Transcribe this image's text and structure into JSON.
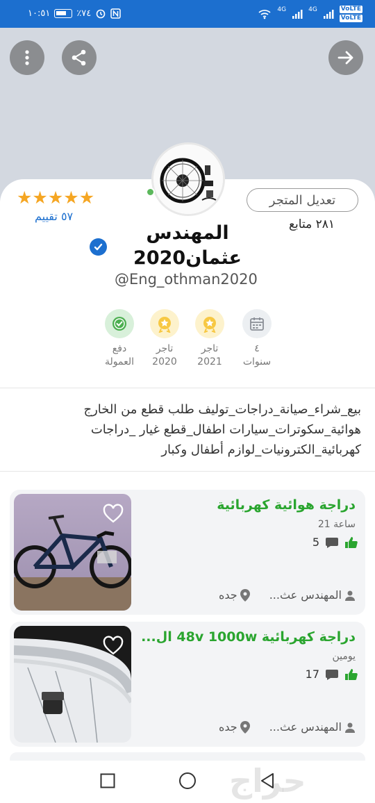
{
  "status_bar": {
    "time": "١٠:٥١",
    "battery": "٪٧٤",
    "network_1": "4G",
    "network_2": "4G",
    "volte_1": "VoLTE",
    "volte_2": "VoLTE"
  },
  "header": {
    "more_icon": "more-vertical-icon",
    "share_icon": "share-icon",
    "forward_icon": "arrow-right-icon"
  },
  "profile": {
    "rating_stars": 5,
    "rating_count": "٥٧ تقييم",
    "edit_store_label": "تعديل المتجر",
    "followers": "٢٨١ متابع",
    "store_name_line1": "المهندس",
    "store_name_line2": "عثمان2020",
    "handle": "@Eng_othman2020",
    "online": true,
    "verified": true
  },
  "badges": [
    {
      "icon": "calendar-icon",
      "line1": "٤",
      "line2": "سنوات"
    },
    {
      "icon": "star-medal-icon",
      "line1": "تاجر",
      "line2": "2021"
    },
    {
      "icon": "star-medal-icon",
      "line1": "تاجر",
      "line2": "2020"
    },
    {
      "icon": "check-seal-icon",
      "line1": "دفع",
      "line2": "العمولة"
    }
  ],
  "bio": "بيع_شراء_صيانة_دراجات_توليف طلب قطع من الخارج هوائية_سكوترات_سيارات اطفال_قطع غيار _دراجات كهربائية_الكترونيات_لوازم أطفال وكبار",
  "listings": [
    {
      "title": "دراجة هوائية كهربائية",
      "time": "21 ساعة",
      "comments": "5",
      "author": "المهندس عث...",
      "city": "جده"
    },
    {
      "title": "دراجة كهربائية 48v 1000w ال...",
      "time": "يومين",
      "comments": "17",
      "author": "المهندس عث...",
      "city": "جده"
    }
  ],
  "navbar": {
    "recent_icon": "square-icon",
    "home_icon": "circle-icon",
    "back_icon": "triangle-back-icon",
    "watermark": "حراج"
  },
  "colors": {
    "status_bar": "#1c6fcf",
    "accent_green": "#2aa52f",
    "star": "#f5a623",
    "link_blue": "#1c6fcf"
  }
}
